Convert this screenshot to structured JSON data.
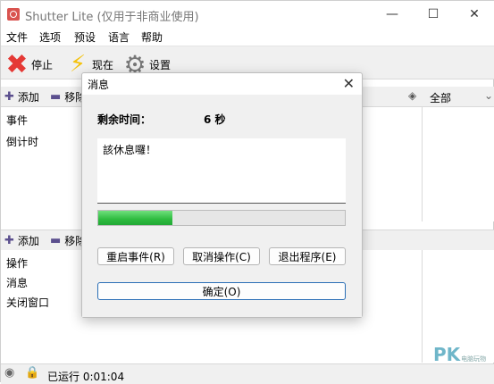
{
  "app": {
    "title": "Shutter Lite (仅用于非商业使用)"
  },
  "menu": [
    "文件",
    "选项",
    "预设",
    "语言",
    "帮助"
  ],
  "toolbar": {
    "stop": "停止",
    "now": "现在",
    "settings": "设置"
  },
  "events": {
    "add": "添加",
    "remove": "移除",
    "rows": [
      "事件",
      "倒计时"
    ],
    "filter": "全部"
  },
  "actions": {
    "add": "添加",
    "remove": "移除",
    "rows": [
      "操作",
      "消息",
      "关闭窗口"
    ]
  },
  "status": {
    "running": "已运行 0:01:04"
  },
  "watermark": {
    "text": "PK",
    "sub": "电脑玩物"
  },
  "dialog": {
    "title": "消息",
    "remaining_label": "剩余时间：",
    "remaining_value": "6 秒",
    "message": "該休息囉！",
    "progress": 0.3,
    "btn_restart": "重启事件(R)",
    "btn_cancel": "取消操作(C)",
    "btn_exit": "退出程序(E)",
    "btn_ok": "确定(O)"
  }
}
